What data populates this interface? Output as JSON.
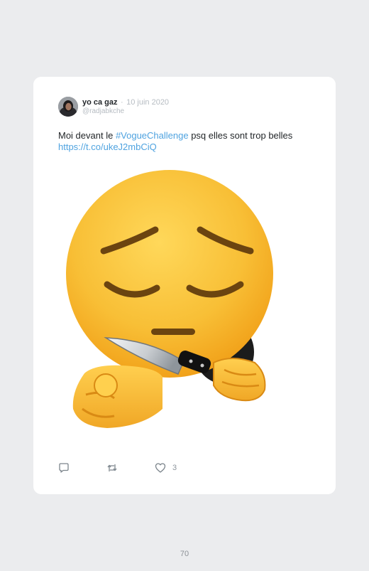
{
  "tweet": {
    "author_name": "yo ca gaz",
    "separator": "·",
    "date": "10 juin 2020",
    "handle": "@radjabkche",
    "text_before": "Moi devant le ",
    "hashtag": "#VogueChallenge",
    "text_after": " psq elles sont trop belles",
    "url": "https://t.co/ukeJ2mbCiQ",
    "like_count": "3"
  },
  "icons": {
    "reply": "reply-icon",
    "retweet": "retweet-icon",
    "like": "heart-icon"
  },
  "colors": {
    "link": "#4fa3e0",
    "background": "#ebecee",
    "card": "#ffffff"
  },
  "page": {
    "number": "70"
  }
}
